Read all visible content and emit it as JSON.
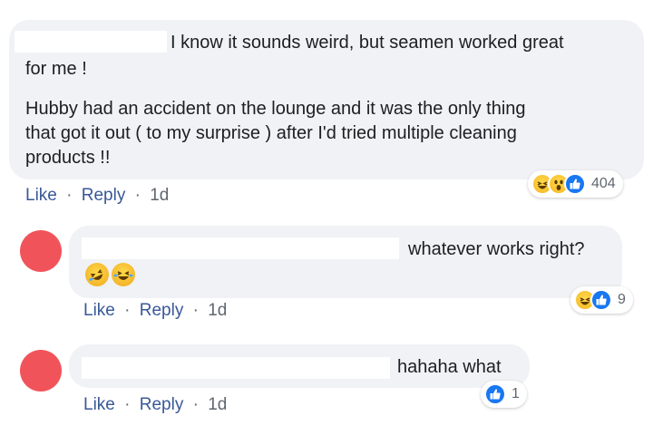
{
  "comments": [
    {
      "line1": "I know it sounds weird, but seamen worked great",
      "line2": "for me !",
      "para2_lines": [
        "Hubby had an accident on the lounge and it was the only thing",
        "that got it out ( to my surprise ) after I'd tried multiple cleaning",
        "products !!"
      ],
      "actions": {
        "like": "Like",
        "sep": "·",
        "reply": "Reply",
        "time": "1d"
      },
      "reactions": {
        "icons": [
          "haha-icon",
          "wow-icon",
          "like-icon"
        ],
        "count": "404"
      }
    },
    {
      "text": "whatever works right?",
      "emojis": [
        "rolling-laughing-emoji",
        "laughing-tears-emoji"
      ],
      "actions": {
        "like": "Like",
        "sep": "·",
        "reply": "Reply",
        "time": "1d"
      },
      "reactions": {
        "icons": [
          "haha-icon",
          "like-icon"
        ],
        "count": "9"
      }
    },
    {
      "text": "hahaha what",
      "actions": {
        "like": "Like",
        "sep": "·",
        "reply": "Reply",
        "time": "1d"
      },
      "reactions": {
        "icons": [
          "like-icon"
        ],
        "count": "1"
      }
    }
  ],
  "colors": {
    "bubble": "#f0f2f5",
    "link": "#385898",
    "avatar": "#f0545a",
    "like_blue": "#1877f2",
    "emoji_yellow": "#f5b623"
  }
}
